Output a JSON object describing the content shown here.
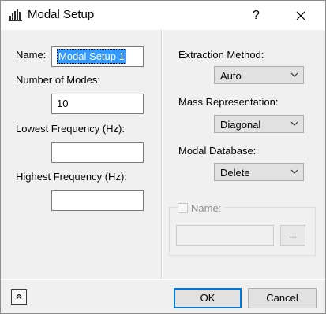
{
  "window": {
    "title": "Modal Setup",
    "help_glyph": "?",
    "icons": {
      "app": "bar-chart-icon",
      "close": "close-icon"
    }
  },
  "left_panel": {
    "name_label": "Name:",
    "name_value": "Modal Setup 1",
    "modes_label": "Number of Modes:",
    "modes_value": "10",
    "lowest_freq_label": "Lowest Frequency (Hz):",
    "lowest_freq_value": "",
    "highest_freq_label": "Highest Frequency (Hz):",
    "highest_freq_value": ""
  },
  "right_panel": {
    "extraction_label": "Extraction Method:",
    "extraction_value": "Auto",
    "mass_label": "Mass Representation:",
    "mass_value": "Diagonal",
    "database_label": "Modal Database:",
    "database_value": "Delete",
    "name_group": {
      "checkbox_label": "Name:",
      "checked": false,
      "path_value": "",
      "browse_label": "..."
    }
  },
  "footer": {
    "ok_label": "OK",
    "cancel_label": "Cancel",
    "expand_icon": "expand-up-icon"
  },
  "colors": {
    "selection": "#3399ff",
    "default_button_border": "#0078d7",
    "dialog_bg": "#f0f0f0"
  }
}
